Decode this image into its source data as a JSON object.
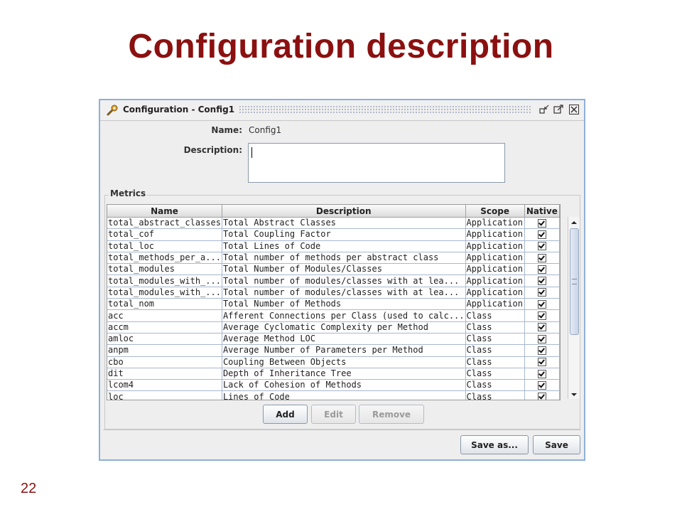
{
  "slide": {
    "title": "Configuration description",
    "number": "22"
  },
  "window": {
    "title": "Configuration - Config1",
    "icons": [
      "wrench-config-icon",
      "minimize-icon",
      "maximize-icon",
      "close-icon"
    ]
  },
  "form": {
    "name_label": "Name:",
    "name_value": "Config1",
    "description_label": "Description:",
    "description_value": ""
  },
  "metrics": {
    "legend": "Metrics",
    "columns": [
      "Name",
      "Description",
      "Scope",
      "Native"
    ],
    "rows": [
      {
        "name": "total_abstract_classes",
        "description": "Total Abstract Classes",
        "scope": "Application",
        "native": true
      },
      {
        "name": "total_cof",
        "description": "Total Coupling Factor",
        "scope": "Application",
        "native": true
      },
      {
        "name": "total_loc",
        "description": "Total Lines of Code",
        "scope": "Application",
        "native": true
      },
      {
        "name": "total_methods_per_a...",
        "description": "Total number of methods per abstract class",
        "scope": "Application",
        "native": true
      },
      {
        "name": "total_modules",
        "description": "Total Number of Modules/Classes",
        "scope": "Application",
        "native": true
      },
      {
        "name": "total_modules_with_...",
        "description": "Total number of modules/classes with at lea...",
        "scope": "Application",
        "native": true
      },
      {
        "name": "total_modules_with_...",
        "description": "Total number of modules/classes with at lea...",
        "scope": "Application",
        "native": true
      },
      {
        "name": "total_nom",
        "description": "Total Number of Methods",
        "scope": "Application",
        "native": true
      },
      {
        "name": "acc",
        "description": "Afferent Connections per Class (used to calc...",
        "scope": "Class",
        "native": true
      },
      {
        "name": "accm",
        "description": "Average Cyclomatic Complexity per Method",
        "scope": "Class",
        "native": true
      },
      {
        "name": "amloc",
        "description": "Average Method LOC",
        "scope": "Class",
        "native": true
      },
      {
        "name": "anpm",
        "description": "Average Number of Parameters per Method",
        "scope": "Class",
        "native": true
      },
      {
        "name": "cbo",
        "description": "Coupling Between Objects",
        "scope": "Class",
        "native": true
      },
      {
        "name": "dit",
        "description": "Depth of Inheritance Tree",
        "scope": "Class",
        "native": true
      },
      {
        "name": "lcom4",
        "description": "Lack of Cohesion of Methods",
        "scope": "Class",
        "native": true
      },
      {
        "name": "loc",
        "description": "Lines of Code",
        "scope": "Class",
        "native": true
      }
    ],
    "buttons": {
      "add": "Add",
      "edit": "Edit",
      "remove": "Remove"
    }
  },
  "footer": {
    "save_as": "Save as...",
    "save": "Save"
  },
  "colors": {
    "title": "#8b1010",
    "window_border": "#8fb0d8"
  }
}
